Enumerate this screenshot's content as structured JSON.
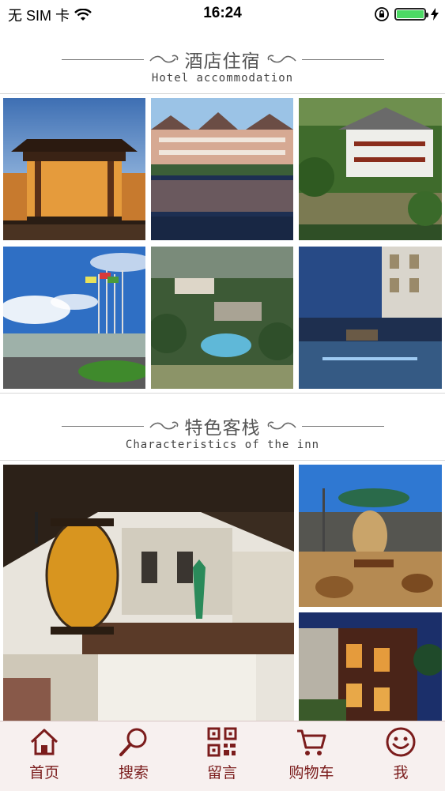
{
  "status_bar": {
    "carrier": "无 SIM 卡",
    "time": "16:24",
    "battery_level": 1.0,
    "battery_color": "#4cd964"
  },
  "sections": [
    {
      "title": "酒店住宿",
      "subtitle": "Hotel accommodation"
    },
    {
      "title": "特色客栈",
      "subtitle": "Characteristics of the inn"
    }
  ],
  "hotel_photos": [
    {
      "name": "temple-style-hotel-night"
    },
    {
      "name": "lakeside-villas-reflection"
    },
    {
      "name": "hillside-villa"
    },
    {
      "name": "hotel-entrance-flags"
    },
    {
      "name": "resort-pool-valley"
    },
    {
      "name": "rooftop-terrace-night"
    }
  ],
  "inn_photos": [
    {
      "name": "courtyard-lantern"
    },
    {
      "name": "rooftop-garden-swing"
    },
    {
      "name": "old-street-night"
    }
  ],
  "tab_bar": {
    "accent_color": "#7b1c1c",
    "items": [
      {
        "label": "首页",
        "icon": "home-icon"
      },
      {
        "label": "搜索",
        "icon": "search-icon"
      },
      {
        "label": "留言",
        "icon": "qr-code-icon"
      },
      {
        "label": "购物车",
        "icon": "cart-icon"
      },
      {
        "label": "我",
        "icon": "smiley-icon"
      }
    ]
  }
}
